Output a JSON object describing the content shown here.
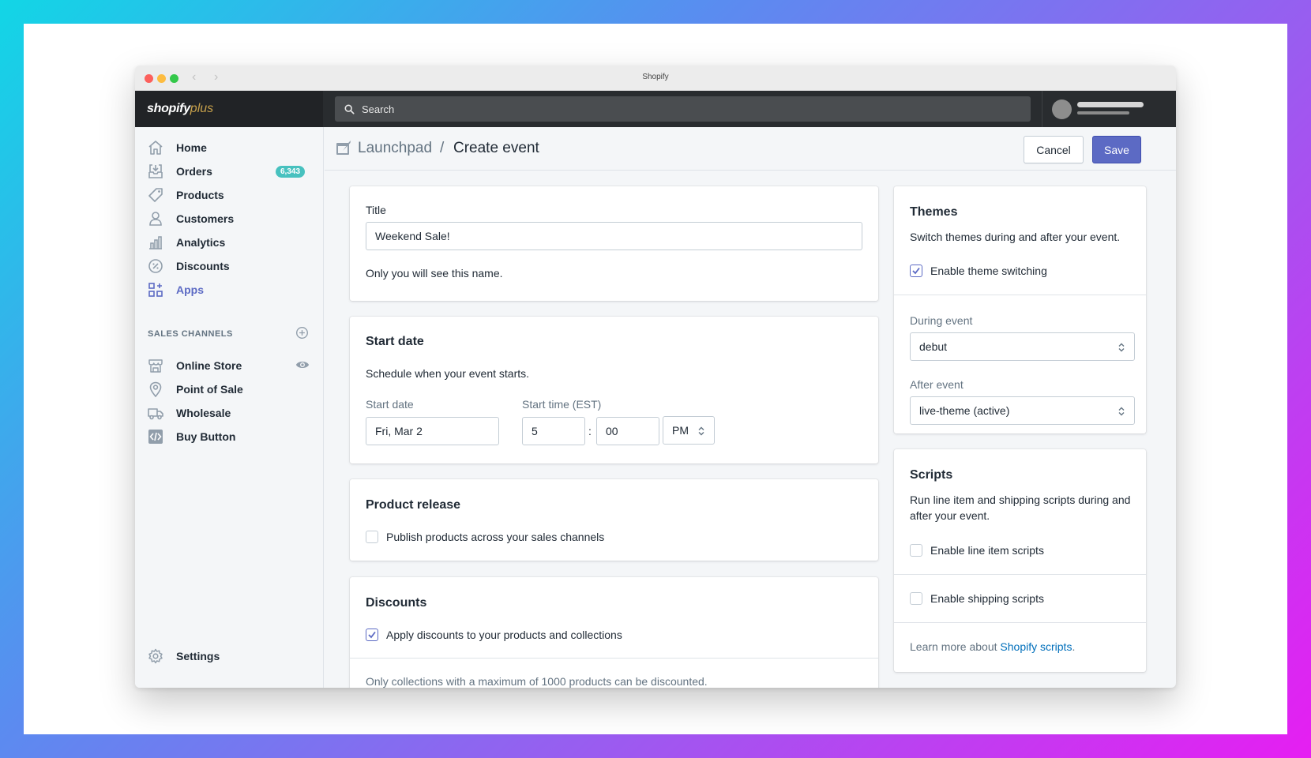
{
  "window": {
    "title": "Shopify"
  },
  "topbar": {
    "logo_main": "shopify",
    "logo_plus": "plus",
    "search_placeholder": "Search"
  },
  "sidebar": {
    "items": [
      {
        "label": "Home",
        "icon": "home-icon"
      },
      {
        "label": "Orders",
        "icon": "orders-icon",
        "badge": "6,343"
      },
      {
        "label": "Products",
        "icon": "tag-icon"
      },
      {
        "label": "Customers",
        "icon": "person-icon"
      },
      {
        "label": "Analytics",
        "icon": "bar-chart-icon"
      },
      {
        "label": "Discounts",
        "icon": "discount-icon"
      },
      {
        "label": "Apps",
        "icon": "apps-icon",
        "active": true
      }
    ],
    "sales_channels_heading": "SALES CHANNELS",
    "channels": [
      {
        "label": "Online Store",
        "icon": "store-icon"
      },
      {
        "label": "Point of Sale",
        "icon": "location-pin-icon"
      },
      {
        "label": "Wholesale",
        "icon": "wholesale-truck-icon"
      },
      {
        "label": "Buy Button",
        "icon": "code-icon"
      }
    ],
    "settings_label": "Settings"
  },
  "header": {
    "breadcrumb_parent": "Launchpad",
    "separator": "/",
    "title": "Create event",
    "cancel_label": "Cancel",
    "save_label": "Save"
  },
  "title_card": {
    "label": "Title",
    "value": "Weekend Sale!",
    "help": "Only you will see this name."
  },
  "start_date_card": {
    "title": "Start date",
    "description": "Schedule when your event starts.",
    "date_label": "Start date",
    "date_value": "Fri, Mar 2",
    "time_label": "Start time (EST)",
    "hour": "5",
    "time_sep": ":",
    "minute": "00",
    "ampm": "PM"
  },
  "product_release_card": {
    "title": "Product release",
    "checkbox_label": "Publish products across your sales channels",
    "checked": false
  },
  "discounts_card": {
    "title": "Discounts",
    "checkbox_label": "Apply discounts to your products and collections",
    "checked": true,
    "note": "Only collections with a maximum of 1000 products can be discounted."
  },
  "themes_card": {
    "title": "Themes",
    "description": "Switch themes during and after your event.",
    "checkbox_label": "Enable theme switching",
    "checked": true,
    "during_label": "During event",
    "during_value": "debut",
    "after_label": "After event",
    "after_value": "live-theme (active)"
  },
  "scripts_card": {
    "title": "Scripts",
    "description": "Run line item and shipping scripts during and after your event.",
    "line_item_label": "Enable line item scripts",
    "shipping_label": "Enable shipping scripts",
    "learn_prefix": "Learn more about ",
    "learn_link": "Shopify scripts",
    "learn_suffix": "."
  },
  "colors": {
    "accent": "#5c6ac4",
    "badge": "#47c1bf",
    "link": "#006fbb",
    "topbar": "#292c2f"
  }
}
